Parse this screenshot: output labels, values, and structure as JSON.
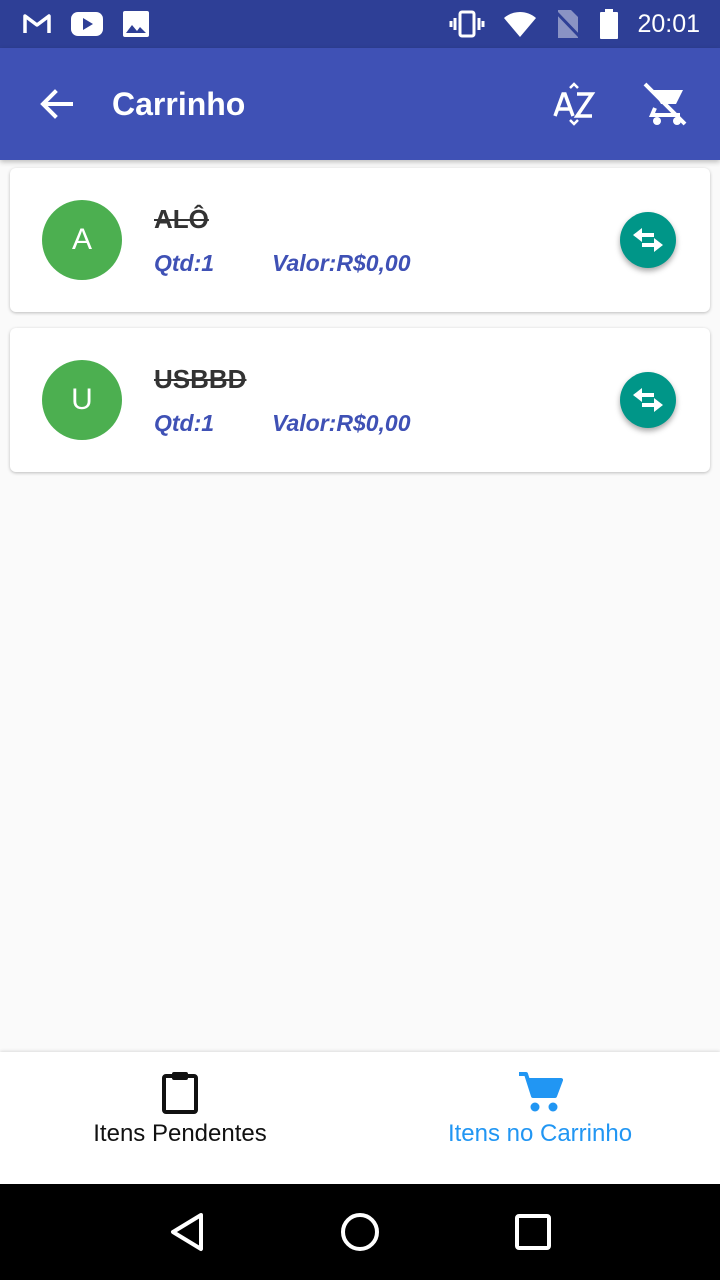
{
  "status_bar": {
    "time": "20:01",
    "left_icons": [
      "gmail-icon",
      "youtube-icon",
      "image-icon"
    ],
    "right_icons": [
      "vibrate-icon",
      "wifi-icon",
      "no-sim-icon",
      "battery-icon"
    ]
  },
  "app_bar": {
    "title": "Carrinho",
    "actions": [
      "sort-alpha-icon",
      "remove-cart-icon"
    ],
    "background": "#3f51b5"
  },
  "items": [
    {
      "avatar": "A",
      "name": "ALÔ",
      "qtd_label": "Qtd:",
      "qtd": "1",
      "valor_label": "Valor:",
      "valor": "R$0,00"
    },
    {
      "avatar": "U",
      "name": "USBBD",
      "qtd_label": "Qtd:",
      "qtd": "1",
      "valor_label": "Valor:",
      "valor": "R$0,00"
    }
  ],
  "bottom_nav": {
    "tabs": [
      {
        "label": "Itens Pendentes",
        "icon": "clipboard-icon",
        "active": false
      },
      {
        "label": "Itens no Carrinho",
        "icon": "cart-icon",
        "active": true
      }
    ],
    "active_color": "#2196f3"
  },
  "system_nav": [
    "back-triangle-icon",
    "home-circle-icon",
    "recents-square-icon"
  ]
}
